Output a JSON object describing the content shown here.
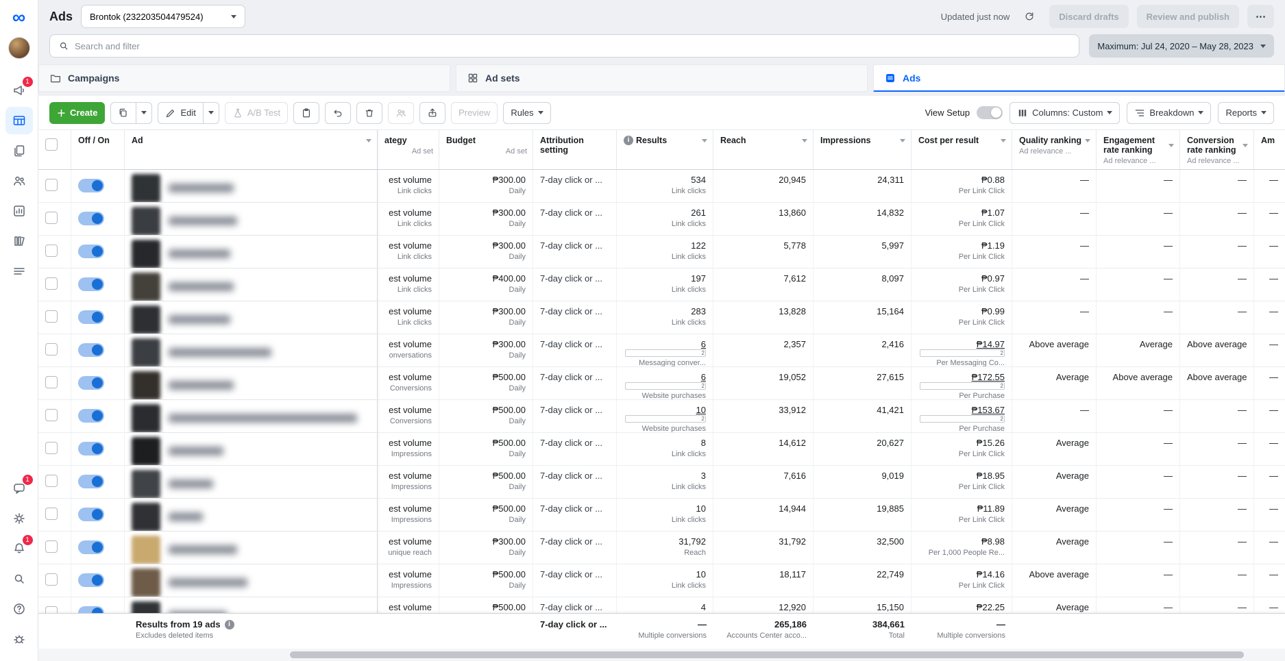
{
  "topbar": {
    "title": "Ads",
    "account": "Brontok (232203504479524)",
    "updated": "Updated just now",
    "discard": "Discard drafts",
    "review": "Review and publish",
    "more": "⋯"
  },
  "search": {
    "placeholder": "Search and filter",
    "date_range": "Maximum: Jul 24, 2020 – May 28, 2023"
  },
  "tabs": {
    "campaigns": "Campaigns",
    "adsets": "Ad sets",
    "ads": "Ads"
  },
  "toolbar": {
    "create": "Create",
    "edit": "Edit",
    "ab_test": "A/B Test",
    "preview": "Preview",
    "rules": "Rules",
    "view_setup": "View Setup",
    "columns": "Columns: Custom",
    "breakdown": "Breakdown",
    "reports": "Reports"
  },
  "sidebar": {
    "badge_updates": "1",
    "badge_help": "1",
    "badge_notifications": "1"
  },
  "colors": {
    "accent": "#0866ff",
    "create_green": "#3ea636",
    "badge_red": "#f02849"
  },
  "table": {
    "headers": {
      "offon": "Off / On",
      "ad": "Ad",
      "strategy": "ategy",
      "strategy_sub": "Ad set",
      "budget": "Budget",
      "budget_sub": "Ad set",
      "attribution": "Attribution setting",
      "results": "Results",
      "reach": "Reach",
      "impressions": "Impressions",
      "cost": "Cost per result",
      "quality": "Quality ranking",
      "quality_sub": "Ad relevance ...",
      "engagement": "Engagement rate ranking",
      "engagement_sub": "Ad relevance ...",
      "conversion": "Conversion rate ranking",
      "conversion_sub": "Ad relevance ...",
      "amount": "Am"
    },
    "rows": [
      {
        "strategy": "est volume",
        "strategy_sub": "Link clicks",
        "budget": "₱300.00",
        "budget_sub": "Daily",
        "attribution": "7-day click or ...",
        "result": "534",
        "result_sub": "Link clicks",
        "reach": "20,945",
        "impressions": "24,311",
        "cost": "₱0.88",
        "cost_sub": "Per Link Click",
        "quality": "—",
        "engagement": "—",
        "conversion": "—",
        "amount": "—"
      },
      {
        "strategy": "est volume",
        "strategy_sub": "Link clicks",
        "budget": "₱300.00",
        "budget_sub": "Daily",
        "attribution": "7-day click or ...",
        "result": "261",
        "result_sub": "Link clicks",
        "reach": "13,860",
        "impressions": "14,832",
        "cost": "₱1.07",
        "cost_sub": "Per Link Click",
        "quality": "—",
        "engagement": "—",
        "conversion": "—",
        "amount": "—"
      },
      {
        "strategy": "est volume",
        "strategy_sub": "Link clicks",
        "budget": "₱300.00",
        "budget_sub": "Daily",
        "attribution": "7-day click or ...",
        "result": "122",
        "result_sub": "Link clicks",
        "reach": "5,778",
        "impressions": "5,997",
        "cost": "₱1.19",
        "cost_sub": "Per Link Click",
        "quality": "—",
        "engagement": "—",
        "conversion": "—",
        "amount": "—"
      },
      {
        "strategy": "est volume",
        "strategy_sub": "Link clicks",
        "budget": "₱400.00",
        "budget_sub": "Daily",
        "attribution": "7-day click or ...",
        "result": "197",
        "result_sub": "Link clicks",
        "reach": "7,612",
        "impressions": "8,097",
        "cost": "₱0.97",
        "cost_sub": "Per Link Click",
        "quality": "—",
        "engagement": "—",
        "conversion": "—",
        "amount": "—"
      },
      {
        "strategy": "est volume",
        "strategy_sub": "Link clicks",
        "budget": "₱300.00",
        "budget_sub": "Daily",
        "attribution": "7-day click or ...",
        "result": "283",
        "result_sub": "Link clicks",
        "reach": "13,828",
        "impressions": "15,164",
        "cost": "₱0.99",
        "cost_sub": "Per Link Click",
        "quality": "—",
        "engagement": "—",
        "conversion": "—",
        "amount": "—"
      },
      {
        "strategy": "est volume",
        "strategy_sub": "onversations",
        "budget": "₱300.00",
        "budget_sub": "Daily",
        "attribution": "7-day click or ...",
        "result": "6",
        "result_sup": "2",
        "result_sub": "Messaging conver...",
        "reach": "2,357",
        "impressions": "2,416",
        "cost": "₱14.97",
        "cost_sup": "2",
        "cost_sub": "Per Messaging Co...",
        "quality": "Above average",
        "engagement": "Average",
        "conversion": "Above average",
        "amount": "—"
      },
      {
        "strategy": "est volume",
        "strategy_sub": "Conversions",
        "budget": "₱500.00",
        "budget_sub": "Daily",
        "attribution": "7-day click or ...",
        "result": "6",
        "result_sup": "2",
        "result_sub": "Website purchases",
        "reach": "19,052",
        "impressions": "27,615",
        "cost": "₱172.55",
        "cost_sup": "2",
        "cost_sub": "Per Purchase",
        "quality": "Average",
        "engagement": "Above average",
        "conversion": "Above average",
        "amount": "—"
      },
      {
        "strategy": "est volume",
        "strategy_sub": "Conversions",
        "budget": "₱500.00",
        "budget_sub": "Daily",
        "attribution": "7-day click or ...",
        "result": "10",
        "result_sup": "2",
        "result_sub": "Website purchases",
        "reach": "33,912",
        "impressions": "41,421",
        "cost": "₱153.67",
        "cost_sup": "2",
        "cost_sub": "Per Purchase",
        "quality": "—",
        "engagement": "—",
        "conversion": "—",
        "amount": "—"
      },
      {
        "strategy": "est volume",
        "strategy_sub": "Impressions",
        "budget": "₱500.00",
        "budget_sub": "Daily",
        "attribution": "7-day click or ...",
        "result": "8",
        "result_sub": "Link clicks",
        "reach": "14,612",
        "impressions": "20,627",
        "cost": "₱15.26",
        "cost_sub": "Per Link Click",
        "quality": "Average",
        "engagement": "—",
        "conversion": "—",
        "amount": "—"
      },
      {
        "strategy": "est volume",
        "strategy_sub": "Impressions",
        "budget": "₱500.00",
        "budget_sub": "Daily",
        "attribution": "7-day click or ...",
        "result": "3",
        "result_sub": "Link clicks",
        "reach": "7,616",
        "impressions": "9,019",
        "cost": "₱18.95",
        "cost_sub": "Per Link Click",
        "quality": "Average",
        "engagement": "—",
        "conversion": "—",
        "amount": "—"
      },
      {
        "strategy": "est volume",
        "strategy_sub": "Impressions",
        "budget": "₱500.00",
        "budget_sub": "Daily",
        "attribution": "7-day click or ...",
        "result": "10",
        "result_sub": "Link clicks",
        "reach": "14,944",
        "impressions": "19,885",
        "cost": "₱11.89",
        "cost_sub": "Per Link Click",
        "quality": "Average",
        "engagement": "—",
        "conversion": "—",
        "amount": "—"
      },
      {
        "strategy": "est volume",
        "strategy_sub": "unique reach",
        "budget": "₱300.00",
        "budget_sub": "Daily",
        "attribution": "7-day click or ...",
        "result": "31,792",
        "result_sub": "Reach",
        "reach": "31,792",
        "impressions": "32,500",
        "cost": "₱8.98",
        "cost_sub": "Per 1,000 People Re...",
        "quality": "Average",
        "engagement": "—",
        "conversion": "—",
        "amount": "—"
      },
      {
        "strategy": "est volume",
        "strategy_sub": "Impressions",
        "budget": "₱500.00",
        "budget_sub": "Daily",
        "attribution": "7-day click or ...",
        "result": "10",
        "result_sub": "Link clicks",
        "reach": "18,117",
        "impressions": "22,749",
        "cost": "₱14.16",
        "cost_sub": "Per Link Click",
        "quality": "Above average",
        "engagement": "—",
        "conversion": "—",
        "amount": "—"
      },
      {
        "strategy": "est volume",
        "strategy_sub": "",
        "budget": "₱500.00",
        "budget_sub": "",
        "attribution": "7-day click or ...",
        "result": "4",
        "result_sub": "",
        "reach": "12,920",
        "impressions": "15,150",
        "cost": "₱22.25",
        "cost_sub": "",
        "quality": "Average",
        "engagement": "—",
        "conversion": "—",
        "amount": "—"
      }
    ],
    "footer": {
      "results_title": "Results from 19 ads",
      "results_note": "Excludes deleted items",
      "attribution": "7-day click or ...",
      "result": "—",
      "result_sub": "Multiple conversions",
      "reach": "265,186",
      "reach_sub": "Accounts Center acco...",
      "impressions": "384,661",
      "impressions_sub": "Total",
      "cost": "—",
      "cost_sub": "Multiple conversions"
    }
  }
}
